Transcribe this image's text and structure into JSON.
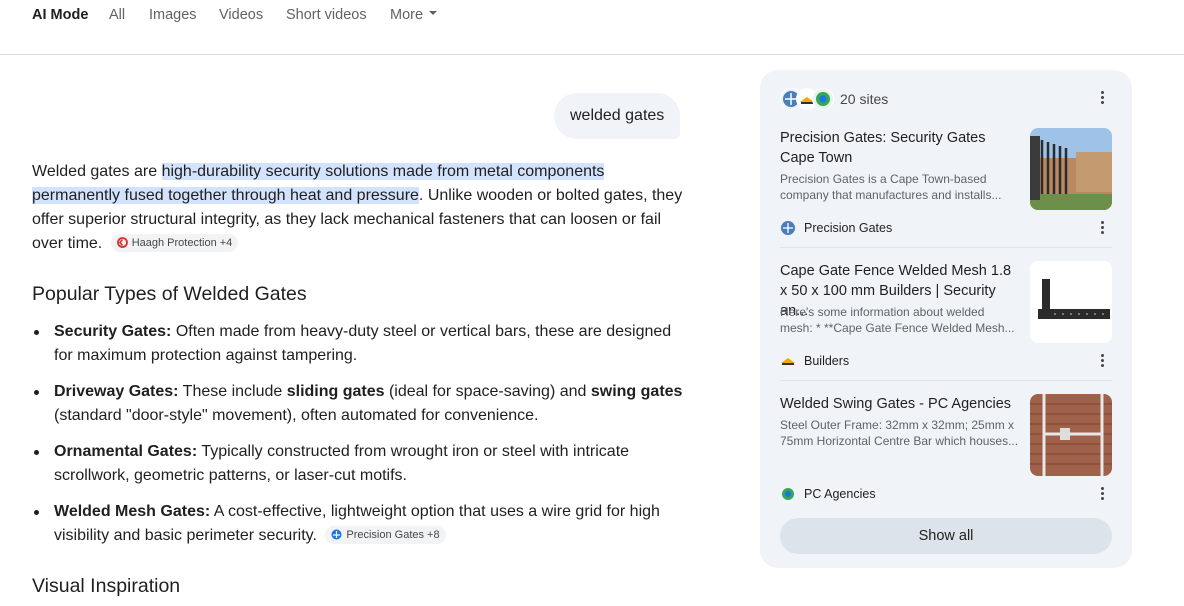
{
  "tabs": {
    "items": [
      "AI Mode",
      "All",
      "Images",
      "Videos",
      "Short videos"
    ],
    "more_label": "More"
  },
  "query": "welded gates",
  "answer": {
    "intro_prefix": "Welded gates are ",
    "intro_highlight_1": "high-durability security solutions made from metal components",
    "intro_highlight_2": "permanently fused together through heat and pressure",
    "intro_rest": ". Unlike wooden or bolted gates, they offer superior structural integrity, as they lack mechanical fasteners that can loosen or fail over time.",
    "intro_chip": "Haagh Protection +4",
    "section_heading": "Popular Types of Welded Gates",
    "types": [
      {
        "name": "Security Gates:",
        "text": " Often made from heavy-duty steel or vertical bars, these are designed for maximum protection against tampering."
      },
      {
        "name": "Driveway Gates:",
        "text_1": " These include ",
        "bold_1": "sliding gates",
        "text_2": " (ideal for space-saving) and ",
        "bold_2": "swing gates",
        "text_3": " (standard \"door-style\" movement), often automated for convenience."
      },
      {
        "name": "Ornamental Gates:",
        "text": " Typically constructed from wrought iron or steel with intricate scrollwork, geometric patterns, or laser-cut motifs."
      },
      {
        "name": "Welded Mesh Gates:",
        "text": " A cost-effective, lightweight option that uses a wire grid for high visibility and basic perimeter security.",
        "chip": "Precision Gates +8"
      }
    ],
    "next_heading": "Visual Inspiration"
  },
  "sources_panel": {
    "count_label": "20 sites",
    "cards": [
      {
        "title": "Precision Gates: Security Gates Cape Town",
        "snippet": "Precision Gates is a Cape Town-based company that manufactures and installs...",
        "source": "Precision Gates",
        "icon": "precision-gates-favicon"
      },
      {
        "title": "Cape Gate Fence Welded Mesh 1.8 x 50 x 100 mm Builders | Security an...",
        "snippet": "Here's some information about welded mesh: * **Cape Gate Fence Welded Mesh...",
        "source": "Builders",
        "icon": "builders-favicon"
      },
      {
        "title": "Welded Swing Gates - PC Agencies",
        "snippet": "Steel Outer Frame: 32mm x 32mm; 25mm x 75mm Horizontal Centre Bar which houses...",
        "source": "PC Agencies",
        "icon": "pc-agencies-favicon"
      }
    ],
    "show_all_label": "Show all"
  },
  "colors": {
    "highlight": "#d3e3fd",
    "panel_bg": "#f0f4f9",
    "query_bubble_bg": "#f0f4f9",
    "show_all_bg": "#dde3ea"
  }
}
